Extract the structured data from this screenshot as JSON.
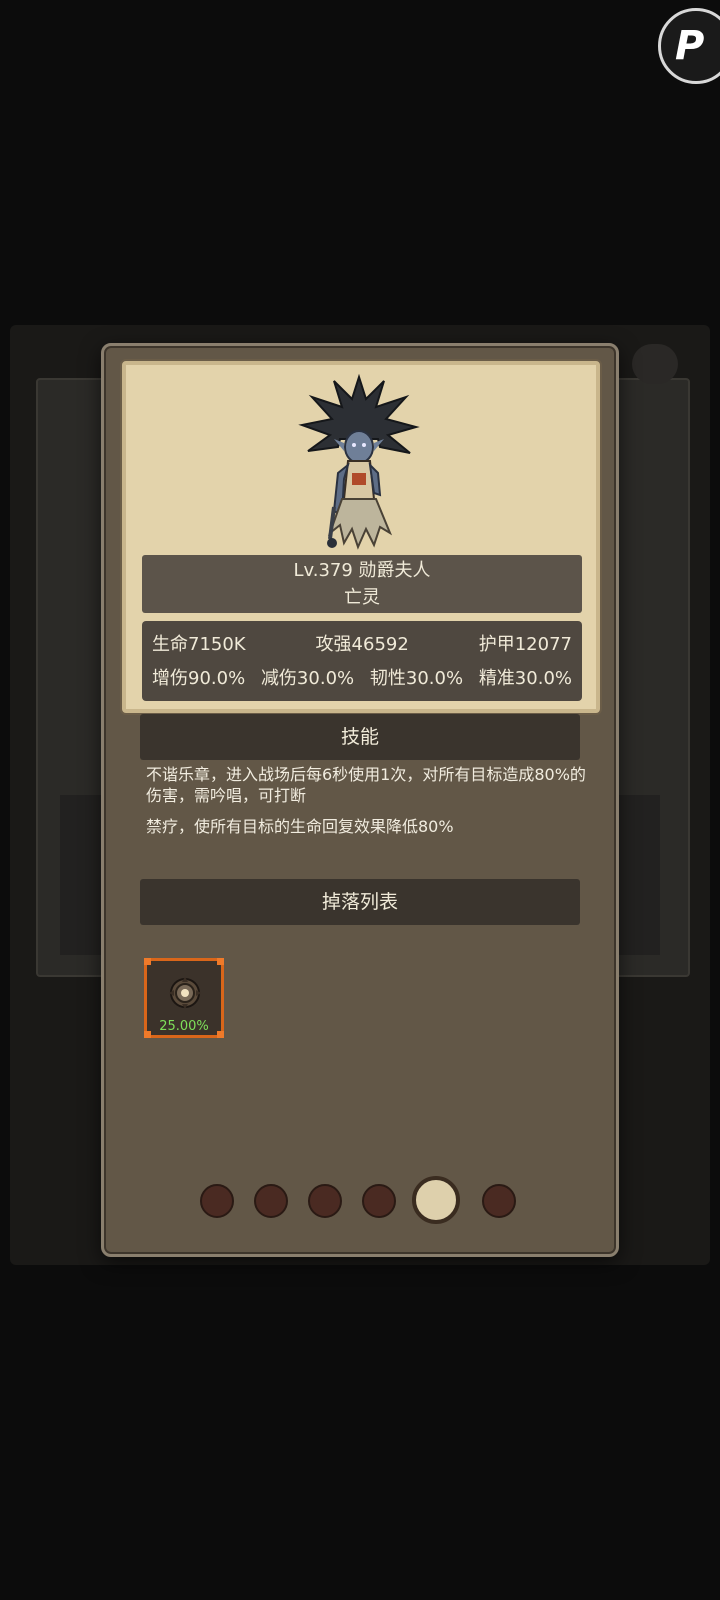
{
  "top_right_button": {
    "label": "P"
  },
  "portrait": {
    "level_name": "Lv.379 勋爵夫人",
    "type": "亡灵"
  },
  "stats": {
    "row1": [
      "生命7150K",
      "攻强46592",
      "护甲12077"
    ],
    "row2": [
      "增伤90.0%",
      "减伤30.0%",
      "韧性30.0%",
      "精准30.0%"
    ]
  },
  "skills": {
    "header": "技能",
    "descriptions": [
      "不谐乐章，进入战场后每6秒使用1次，对所有目标造成80%的伤害，需吟唱，可打断",
      "禁疗，使所有目标的生命回复效果降低80%"
    ]
  },
  "drops": {
    "header": "掉落列表",
    "items": [
      {
        "icon": "gear-amulet-icon",
        "rate": "25.00%",
        "border_color": "#d9661a"
      }
    ]
  },
  "pagination": {
    "count": 6,
    "active_index": 4
  }
}
